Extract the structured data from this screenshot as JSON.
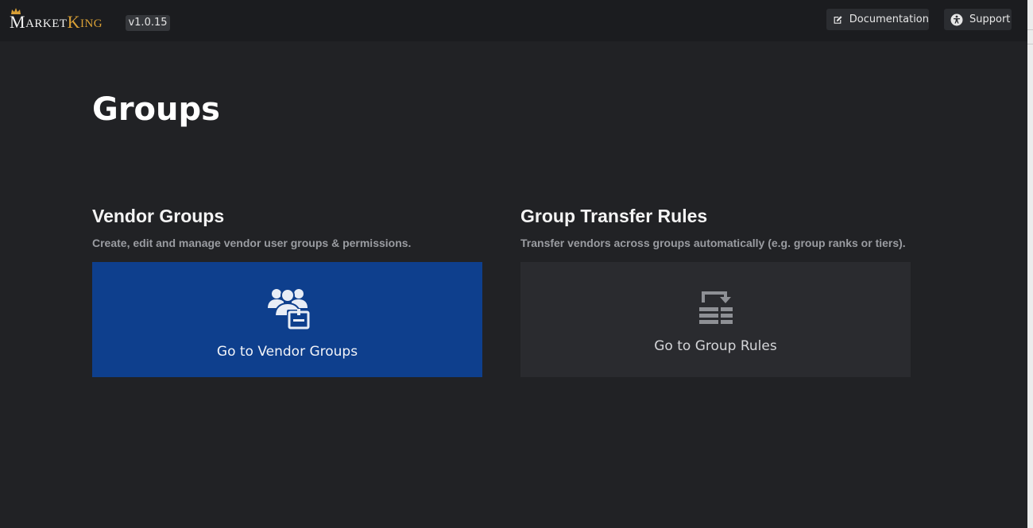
{
  "header": {
    "logo_text_market": "Market",
    "logo_text_king": "King",
    "version": "v1.0.15",
    "documentation_label": "Documentation",
    "support_label": "Support"
  },
  "page": {
    "title": "Groups"
  },
  "sections": [
    {
      "title": "Vendor Groups",
      "description": "Create, edit and manage vendor user groups & permissions.",
      "button_label": "Go to Vendor Groups",
      "icon": "vendor-groups-icon",
      "color": "#0e3f8d"
    },
    {
      "title": "Group Transfer Rules",
      "description": "Transfer vendors across groups automatically (e.g. group ranks or tiers).",
      "button_label": "Go to Group Rules",
      "icon": "group-rules-icon",
      "color": "#2a2b2f"
    }
  ],
  "colors": {
    "background": "#212225",
    "topbar": "#1b1c1f",
    "accent_gold": "#d9a036"
  }
}
